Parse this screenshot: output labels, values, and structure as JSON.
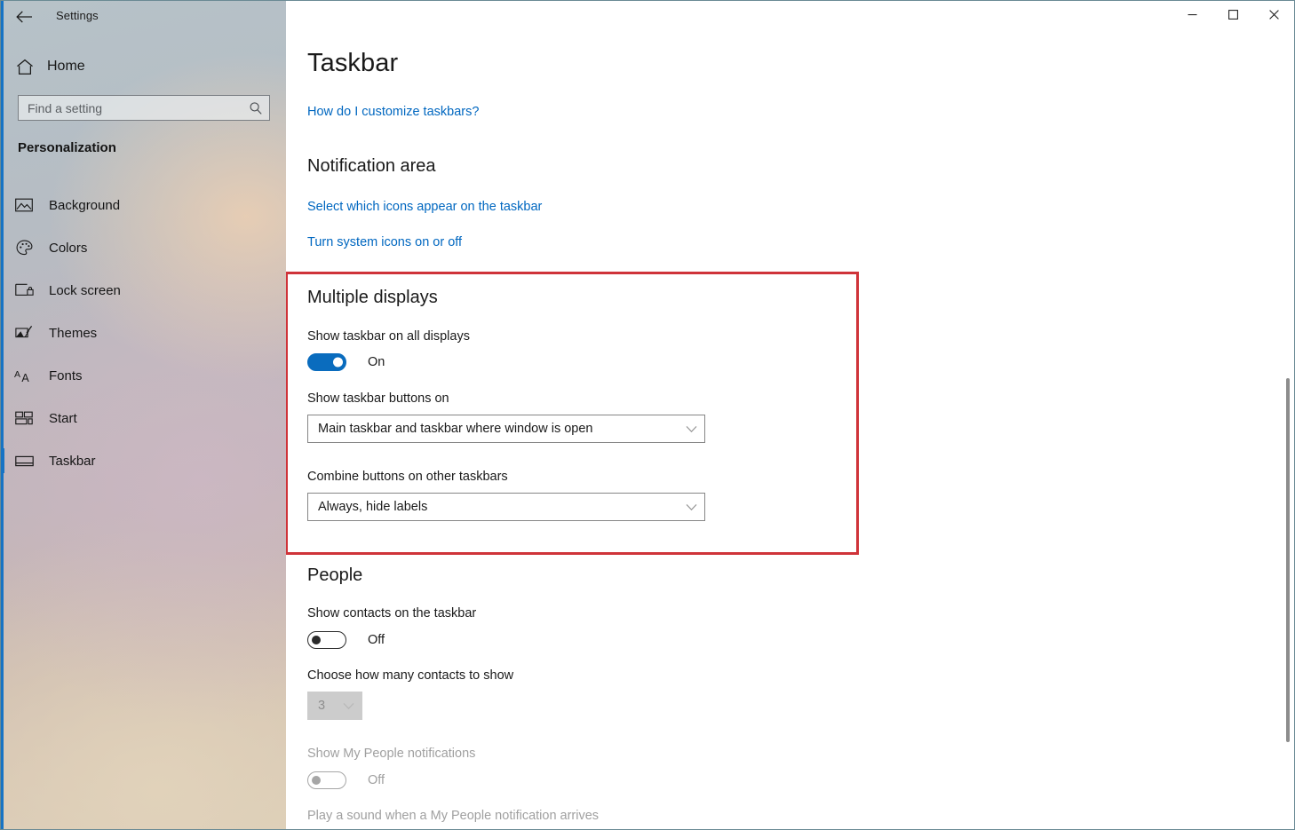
{
  "window": {
    "back_label": "back-arrow",
    "app_title": "Settings",
    "controls": {
      "minimize": "minimize",
      "maximize": "maximize",
      "close": "close"
    }
  },
  "sidebar": {
    "home_label": "Home",
    "search": {
      "placeholder": "Find a setting",
      "value": ""
    },
    "category": "Personalization",
    "items": [
      {
        "label": "Background",
        "icon": "image-icon",
        "selected": false
      },
      {
        "label": "Colors",
        "icon": "palette-icon",
        "selected": false
      },
      {
        "label": "Lock screen",
        "icon": "lock-screen-icon",
        "selected": false
      },
      {
        "label": "Themes",
        "icon": "themes-brush-icon",
        "selected": false
      },
      {
        "label": "Fonts",
        "icon": "fonts-aa-icon",
        "selected": false
      },
      {
        "label": "Start",
        "icon": "start-tiles-icon",
        "selected": false
      },
      {
        "label": "Taskbar",
        "icon": "taskbar-icon",
        "selected": true
      }
    ]
  },
  "main": {
    "page_title": "Taskbar",
    "help_link": "How do I customize taskbars?",
    "notification_area": {
      "heading": "Notification area",
      "link_select_icons": "Select which icons appear on the taskbar",
      "link_system_icons": "Turn system icons on or off"
    },
    "multiple_displays": {
      "heading": "Multiple displays",
      "show_all_displays": {
        "label": "Show taskbar on all displays",
        "state": "On",
        "enabled": true
      },
      "show_buttons_on": {
        "label": "Show taskbar buttons on",
        "value": "Main taskbar and taskbar where window is open"
      },
      "combine_buttons": {
        "label": "Combine buttons on other taskbars",
        "value": "Always, hide labels"
      }
    },
    "people": {
      "heading": "People",
      "show_contacts": {
        "label": "Show contacts on the taskbar",
        "state": "Off"
      },
      "contacts_count": {
        "label": "Choose how many contacts to show",
        "value": "3"
      },
      "my_people_notifications": {
        "label": "Show My People notifications",
        "state": "Off"
      },
      "play_sound_label": "Play a sound when a My People notification arrives"
    }
  },
  "colors": {
    "accent": "#0a6cbe",
    "link": "#0067c0",
    "highlight_box": "#cf3339",
    "selection_bar": "#1673c4"
  }
}
